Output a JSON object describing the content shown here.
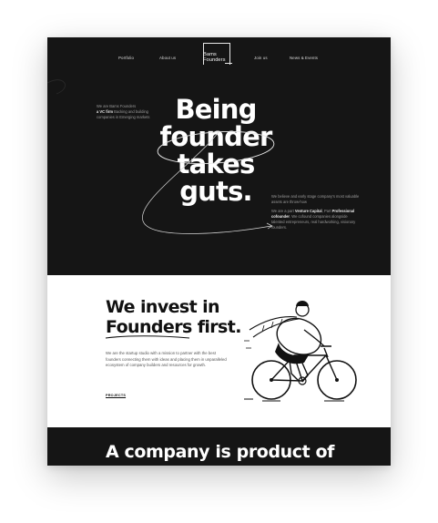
{
  "nav": {
    "links": [
      "Portfolio",
      "About us",
      "Join us",
      "News & Events"
    ],
    "logo": [
      "Bams",
      "Founders"
    ]
  },
  "hero": {
    "intro_left": {
      "prefix": "We are Bams Founders",
      "strong": "a VC firm",
      "suffix": " Backing and building companies in Emerging markets"
    },
    "headline": [
      "Being",
      "founder",
      "takes",
      "guts."
    ],
    "intro_right": {
      "para1": "We believe and early stage company's most valuable assets are throw-how",
      "para2_prefix": "We are a part ",
      "para2_strong1": "Venture Capital",
      "para2_mid": ", Part ",
      "para2_strong2": "Professional cofounder",
      "para2_suffix": ". We cofound companies alongside talented entrepreneurs, real hardworking, visionary founders."
    }
  },
  "invest": {
    "title_line1": "We invest in",
    "title_line2": "Founders first.",
    "body": "We are the startup studio with a mission to partner with the best founders connecting them with ideas and placing them in unparalleled ecosystem of company builders and resources for growth.",
    "link": "PROJECTS"
  },
  "company": {
    "title": "A company is product of"
  },
  "colors": {
    "dark": "#151515",
    "light": "#ffffff",
    "muted": "#9a9a9a"
  }
}
